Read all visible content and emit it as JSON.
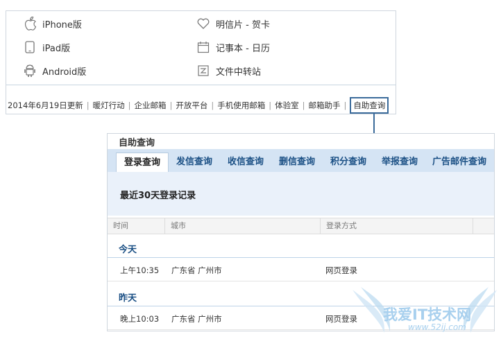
{
  "apps": {
    "iphone": "iPhone版",
    "ipad": "iPad版",
    "android": "Android版",
    "postcard": "明信片 - 贺卡",
    "notebook": "记事本 - 日历",
    "transfer": "文件中转站"
  },
  "footer": {
    "update": "2014年6月19日更新",
    "links": [
      "暖灯行动",
      "企业邮箱",
      "开放平台",
      "手机使用邮箱",
      "体验室",
      "邮箱助手"
    ],
    "self_query": "自助查询"
  },
  "query_panel": {
    "title": "自助查询",
    "tabs": [
      "登录查询",
      "发信查询",
      "收信查询",
      "删信查询",
      "积分查询",
      "举报查询",
      "广告邮件查询"
    ],
    "active_tab": "登录查询",
    "section_title": "最近30天登录记录",
    "columns": [
      "时间",
      "城市",
      "登录方式"
    ],
    "groups": [
      {
        "label": "今天",
        "rows": [
          {
            "time": "上午10:35",
            "city": "广东省 广州市",
            "method": "网页登录"
          }
        ]
      },
      {
        "label": "昨天",
        "rows": [
          {
            "time": "晚上10:03",
            "city": "广东省 广州市",
            "method": "网页登录"
          }
        ]
      }
    ]
  },
  "watermark": {
    "text": "我爱IT技术网",
    "url": "www.52ij.com"
  },
  "colors": {
    "tab_bar": "#d5e4f4",
    "link_blue": "#1a4f84",
    "highlight_border": "#3a6a9a"
  }
}
